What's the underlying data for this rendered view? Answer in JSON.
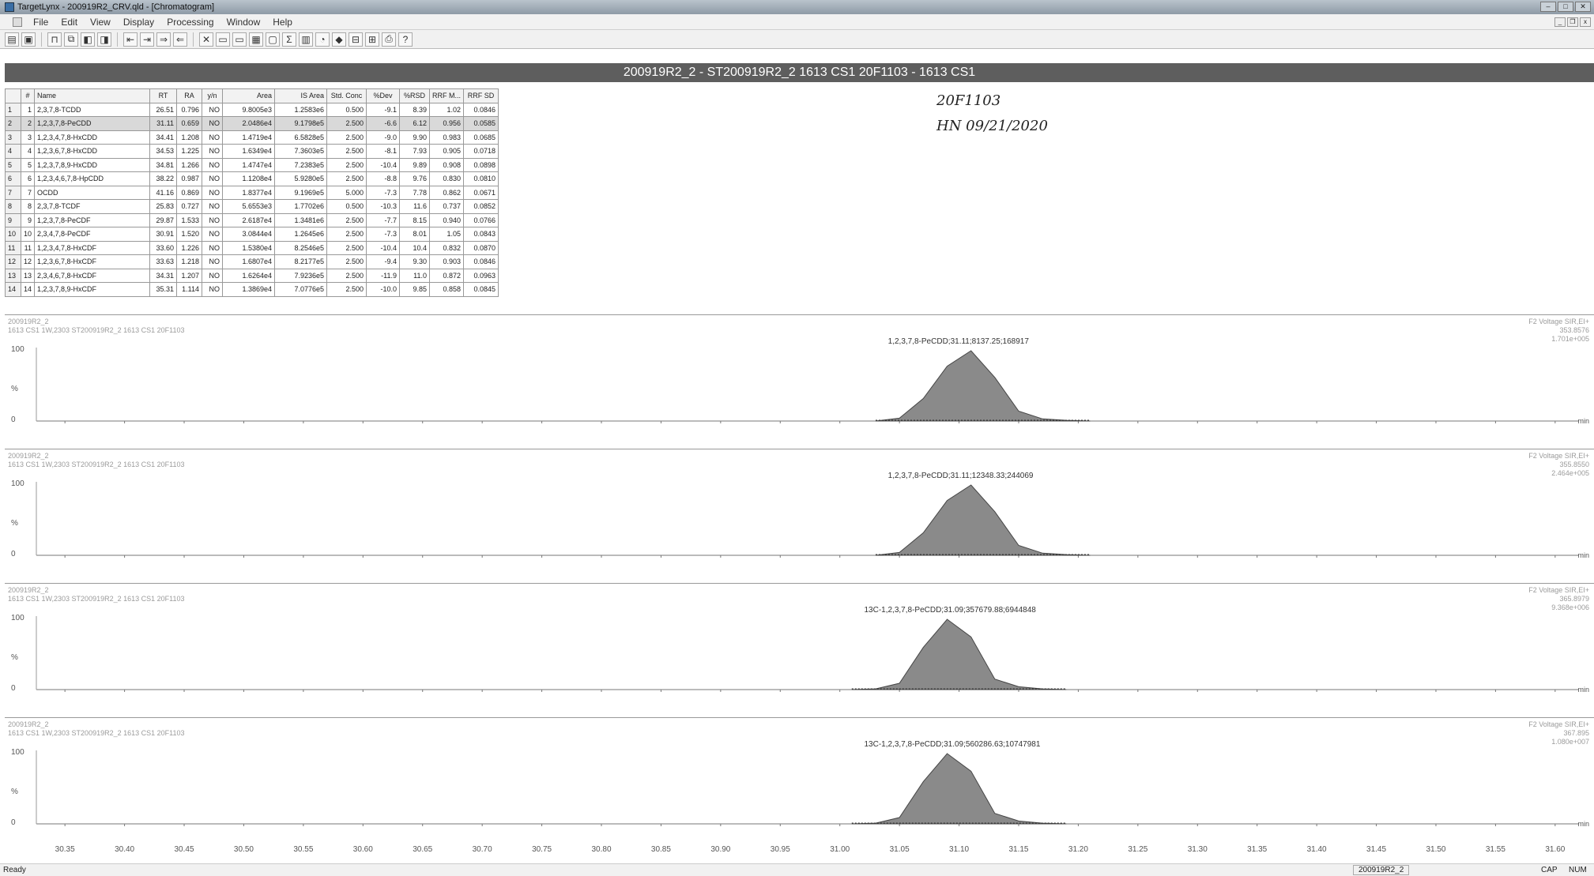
{
  "window": {
    "title": "TargetLynx - 200919R2_CRV.qld - [Chromatogram]"
  },
  "menu": [
    "File",
    "Edit",
    "View",
    "Display",
    "Processing",
    "Window",
    "Help"
  ],
  "sample_title": "200919R2_2 - ST200919R2_2 1613 CS1 20F1103 - 1613 CS1",
  "annotation": {
    "line1": "20F1103",
    "line2": "HN 09/21/2020"
  },
  "table": {
    "headers": [
      "#",
      "Name",
      "RT",
      "RA",
      "y/n",
      "Area",
      "IS Area",
      "Std. Conc",
      "%Dev",
      "%RSD",
      "RRF M...",
      "RRF SD"
    ],
    "rows": [
      [
        "1",
        "1",
        "2,3,7,8-TCDD",
        "26.51",
        "0.796",
        "NO",
        "9.8005e3",
        "1.2583e6",
        "0.500",
        "-9.1",
        "8.39",
        "1.02",
        "0.0846"
      ],
      [
        "2",
        "2",
        "1,2,3,7,8-PeCDD",
        "31.11",
        "0.659",
        "NO",
        "2.0486e4",
        "9.1798e5",
        "2.500",
        "-6.6",
        "6.12",
        "0.956",
        "0.0585"
      ],
      [
        "3",
        "3",
        "1,2,3,4,7,8-HxCDD",
        "34.41",
        "1.208",
        "NO",
        "1.4719e4",
        "6.5828e5",
        "2.500",
        "-9.0",
        "9.90",
        "0.983",
        "0.0685"
      ],
      [
        "4",
        "4",
        "1,2,3,6,7,8-HxCDD",
        "34.53",
        "1.225",
        "NO",
        "1.6349e4",
        "7.3603e5",
        "2.500",
        "-8.1",
        "7.93",
        "0.905",
        "0.0718"
      ],
      [
        "5",
        "5",
        "1,2,3,7,8,9-HxCDD",
        "34.81",
        "1.266",
        "NO",
        "1.4747e4",
        "7.2383e5",
        "2.500",
        "-10.4",
        "9.89",
        "0.908",
        "0.0898"
      ],
      [
        "6",
        "6",
        "1,2,3,4,6,7,8-HpCDD",
        "38.22",
        "0.987",
        "NO",
        "1.1208e4",
        "5.9280e5",
        "2.500",
        "-8.8",
        "9.76",
        "0.830",
        "0.0810"
      ],
      [
        "7",
        "7",
        "OCDD",
        "41.16",
        "0.869",
        "NO",
        "1.8377e4",
        "9.1969e5",
        "5.000",
        "-7.3",
        "7.78",
        "0.862",
        "0.0671"
      ],
      [
        "8",
        "8",
        "2,3,7,8-TCDF",
        "25.83",
        "0.727",
        "NO",
        "5.6553e3",
        "1.7702e6",
        "0.500",
        "-10.3",
        "11.6",
        "0.737",
        "0.0852"
      ],
      [
        "9",
        "9",
        "1,2,3,7,8-PeCDF",
        "29.87",
        "1.533",
        "NO",
        "2.6187e4",
        "1.3481e6",
        "2.500",
        "-7.7",
        "8.15",
        "0.940",
        "0.0766"
      ],
      [
        "10",
        "10",
        "2,3,4,7,8-PeCDF",
        "30.91",
        "1.520",
        "NO",
        "3.0844e4",
        "1.2645e6",
        "2.500",
        "-7.3",
        "8.01",
        "1.05",
        "0.0843"
      ],
      [
        "11",
        "11",
        "1,2,3,4,7,8-HxCDF",
        "33.60",
        "1.226",
        "NO",
        "1.5380e4",
        "8.2546e5",
        "2.500",
        "-10.4",
        "10.4",
        "0.832",
        "0.0870"
      ],
      [
        "12",
        "12",
        "1,2,3,6,7,8-HxCDF",
        "33.63",
        "1.218",
        "NO",
        "1.6807e4",
        "8.2177e5",
        "2.500",
        "-9.4",
        "9.30",
        "0.903",
        "0.0846"
      ],
      [
        "13",
        "13",
        "2,3,4,6,7,8-HxCDF",
        "34.31",
        "1.207",
        "NO",
        "1.6264e4",
        "7.9236e5",
        "2.500",
        "-11.9",
        "11.0",
        "0.872",
        "0.0963"
      ],
      [
        "14",
        "14",
        "1,2,3,7,8,9-HxCDF",
        "35.31",
        "1.114",
        "NO",
        "1.3869e4",
        "7.0776e5",
        "2.500",
        "-10.0",
        "9.85",
        "0.858",
        "0.0845"
      ]
    ]
  },
  "chromatograms": [
    {
      "hdr_left1": "200919R2_2",
      "hdr_left2": "1613 CS1 1W,2303 ST200919R2_2 1613 CS1 20F1103",
      "hdr_right1": "F2 Voltage SIR,EI+",
      "hdr_right2": "353.8576",
      "hdr_right3": "1.701e+005",
      "peak_label": "1,2,3,7,8-PeCDD;31.11;8137.25;168917"
    },
    {
      "hdr_left1": "200919R2_2",
      "hdr_left2": "1613 CS1 1W,2303 ST200919R2_2 1613 CS1 20F1103",
      "hdr_right1": "F2 Voltage SIR,EI+",
      "hdr_right2": "355.8550",
      "hdr_right3": "2.464e+005",
      "peak_label": "1,2,3,7,8-PeCDD;31.11;12348.33;244069"
    },
    {
      "hdr_left1": "200919R2_2",
      "hdr_left2": "1613 CS1 1W,2303 ST200919R2_2 1613 CS1 20F1103",
      "hdr_right1": "F2 Voltage SIR,EI+",
      "hdr_right2": "365.8979",
      "hdr_right3": "9.368e+006",
      "peak_label": "13C-1,2,3,7,8-PeCDD;31.09;357679.88;6944848"
    },
    {
      "hdr_left1": "200919R2_2",
      "hdr_left2": "1613 CS1 1W,2303 ST200919R2_2 1613 CS1 20F1103",
      "hdr_right1": "F2 Voltage SIR,EI+",
      "hdr_right2": "367.895",
      "hdr_right3": "1.080e+007",
      "peak_label": "13C-1,2,3,7,8-PeCDD;31.09;560286.63;10747981"
    }
  ],
  "axis": {
    "y_labels": [
      "100",
      "%",
      "0"
    ],
    "x_unit": "min",
    "x_ticks": [
      "30.35",
      "30.40",
      "30.45",
      "30.50",
      "30.55",
      "30.60",
      "30.65",
      "30.70",
      "30.75",
      "30.80",
      "30.85",
      "30.90",
      "30.95",
      "31.00",
      "31.05",
      "31.10",
      "31.15",
      "31.20",
      "31.25",
      "31.30",
      "31.35",
      "31.40",
      "31.45",
      "31.50",
      "31.55",
      "31.60"
    ]
  },
  "chart_data": [
    {
      "type": "area",
      "peak_rt": 31.11,
      "x_range": [
        30.33,
        31.62
      ],
      "y_range": [
        0,
        100
      ],
      "x": [
        31.03,
        31.05,
        31.07,
        31.09,
        31.11,
        31.13,
        31.15,
        31.17,
        31.19,
        31.21
      ],
      "y": [
        0,
        4,
        32,
        78,
        100,
        62,
        14,
        3,
        1,
        0
      ]
    },
    {
      "type": "area",
      "peak_rt": 31.11,
      "x_range": [
        30.33,
        31.62
      ],
      "y_range": [
        0,
        100
      ],
      "x": [
        31.03,
        31.05,
        31.07,
        31.09,
        31.11,
        31.13,
        31.15,
        31.17,
        31.19,
        31.21
      ],
      "y": [
        0,
        4,
        32,
        78,
        100,
        62,
        14,
        3,
        1,
        0
      ]
    },
    {
      "type": "area",
      "peak_rt": 31.09,
      "x_range": [
        30.33,
        31.62
      ],
      "y_range": [
        0,
        100
      ],
      "x": [
        31.01,
        31.03,
        31.05,
        31.07,
        31.09,
        31.11,
        31.13,
        31.15,
        31.17,
        31.19
      ],
      "y": [
        0,
        1,
        9,
        60,
        100,
        75,
        15,
        4,
        1,
        0
      ]
    },
    {
      "type": "area",
      "peak_rt": 31.09,
      "x_range": [
        30.33,
        31.62
      ],
      "y_range": [
        0,
        100
      ],
      "x": [
        31.01,
        31.03,
        31.05,
        31.07,
        31.09,
        31.11,
        31.13,
        31.15,
        31.17,
        31.19
      ],
      "y": [
        0,
        1,
        9,
        60,
        100,
        75,
        15,
        4,
        1,
        0
      ]
    }
  ],
  "status": {
    "ready": "Ready",
    "doc": "200919R2_2",
    "cap": "CAP",
    "num": "NUM"
  }
}
